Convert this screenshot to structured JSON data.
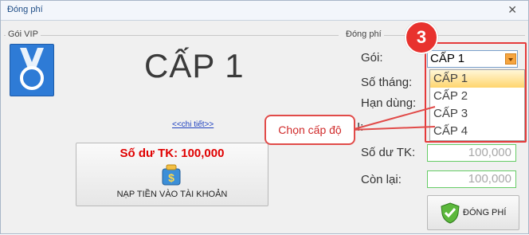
{
  "window": {
    "title": "Đóng phí",
    "close_icon": "close-icon"
  },
  "left_section": {
    "label": "Gói VIP",
    "level_text": "CẤP 1",
    "detail_link": "<<chi tiết>>",
    "balance_text": "Số dư TK: 100,000",
    "topup_button": "NẠP TIỀN VÀO TÀI KHOẢN"
  },
  "right_section": {
    "label": "Đóng phí",
    "package_label": "Gói:",
    "package_value": "CẤP 1",
    "months_label": "Số tháng:",
    "expiry_label": "Hạn dùng:",
    "hidden_label_fragment": "I:",
    "balance_label": "Số dư TK:",
    "balance_value": "100,000",
    "remaining_label": "Còn lại:",
    "remaining_value": "100,000",
    "pay_button": "ĐÓNG PHÍ"
  },
  "dropdown": {
    "options": [
      "CẤP 1",
      "CẤP 2",
      "CẤP 3",
      "CẤP 4"
    ],
    "selected_index": 0
  },
  "annotation": {
    "step_number": "3",
    "callout_text": "Chọn cấp độ",
    "color": "#e53a3a"
  },
  "colors": {
    "accent_red": "#e00000",
    "link_blue": "#1c3fbf",
    "input_border": "#66cc66"
  }
}
